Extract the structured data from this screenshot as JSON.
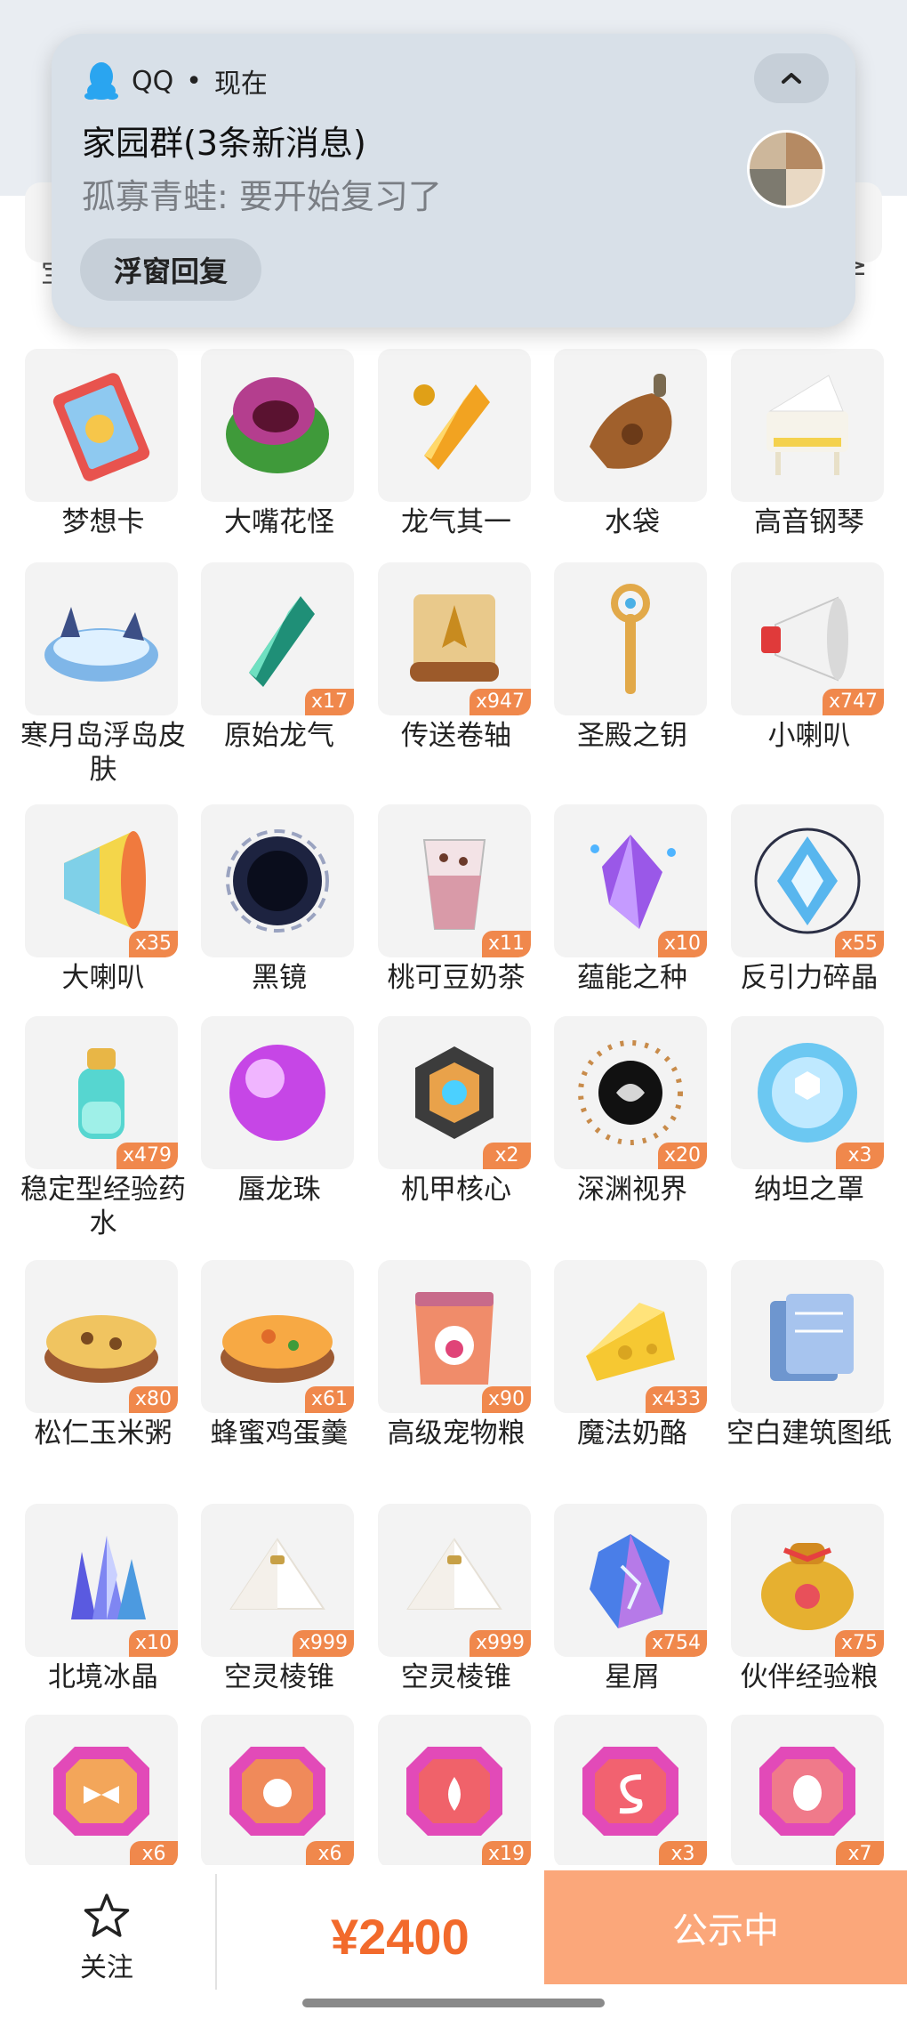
{
  "notification": {
    "app_name": "QQ",
    "separator": "•",
    "time": "现在",
    "title": "家园群(3条新消息)",
    "message": "孤寡青蛙: 要开始复习了",
    "reply_button": "浮窗回复",
    "icons": {
      "app": "qq-penguin-icon",
      "collapse": "chevron-up-icon",
      "avatar": "group-avatar"
    }
  },
  "items": [
    {
      "name": "梦想卡",
      "count": "",
      "icon": "dream-card"
    },
    {
      "name": "大嘴花怪",
      "count": "",
      "icon": "piranha-plant"
    },
    {
      "name": "龙气其一",
      "count": "",
      "icon": "dragon-crystal-gold"
    },
    {
      "name": "水袋",
      "count": "",
      "icon": "water-bag"
    },
    {
      "name": "高音钢琴",
      "count": "",
      "icon": "white-piano"
    },
    {
      "name": "寒月岛浮岛皮肤",
      "count": "",
      "icon": "floating-island"
    },
    {
      "name": "原始龙气",
      "count": "x17",
      "icon": "dragon-crystal-green"
    },
    {
      "name": "传送卷轴",
      "count": "x947",
      "icon": "teleport-scroll"
    },
    {
      "name": "圣殿之钥",
      "count": "",
      "icon": "temple-key"
    },
    {
      "name": "小喇叭",
      "count": "x747",
      "icon": "small-megaphone"
    },
    {
      "name": "大喇叭",
      "count": "x35",
      "icon": "big-megaphone"
    },
    {
      "name": "黑镜",
      "count": "",
      "icon": "black-mirror"
    },
    {
      "name": "桃可豆奶茶",
      "count": "x11",
      "icon": "milk-tea"
    },
    {
      "name": "蕴能之种",
      "count": "x10",
      "icon": "energy-seed"
    },
    {
      "name": "反引力碎晶",
      "count": "x55",
      "icon": "antigravity-crystal"
    },
    {
      "name": "稳定型经验药水",
      "count": "x479",
      "icon": "exp-potion"
    },
    {
      "name": "蜃龙珠",
      "count": "",
      "icon": "purple-orb"
    },
    {
      "name": "机甲核心",
      "count": "x2",
      "icon": "mech-core"
    },
    {
      "name": "深渊视界",
      "count": "x20",
      "icon": "abyss-eye"
    },
    {
      "name": "纳坦之罩",
      "count": "x3",
      "icon": "hex-shield"
    },
    {
      "name": "松仁玉米粥",
      "count": "x80",
      "icon": "corn-porridge"
    },
    {
      "name": "蜂蜜鸡蛋羹",
      "count": "x61",
      "icon": "egg-custard"
    },
    {
      "name": "高级宠物粮",
      "count": "x90",
      "icon": "pet-food-bag"
    },
    {
      "name": "魔法奶酪",
      "count": "x433",
      "icon": "magic-cheese"
    },
    {
      "name": "空白建筑图纸",
      "count": "",
      "icon": "blueprint"
    },
    {
      "name": "北境冰晶",
      "count": "x10",
      "icon": "ice-crystal"
    },
    {
      "name": "空灵棱锥",
      "count": "x999",
      "icon": "ethereal-pyramid"
    },
    {
      "name": "空灵棱锥",
      "count": "x999",
      "icon": "ethereal-pyramid"
    },
    {
      "name": "星屑",
      "count": "x754",
      "icon": "stardust"
    },
    {
      "name": "伙伴经验粮",
      "count": "x75",
      "icon": "partner-exp-bag"
    },
    {
      "name": "",
      "count": "x6",
      "icon": "gem-bow"
    },
    {
      "name": "",
      "count": "x6",
      "icon": "gem-demon"
    },
    {
      "name": "",
      "count": "x19",
      "icon": "gem-flame"
    },
    {
      "name": "",
      "count": "x3",
      "icon": "gem-s"
    },
    {
      "name": "",
      "count": "x7",
      "icon": "gem-egg"
    }
  ],
  "bottom_bar": {
    "follow_label": "关注",
    "price": "¥2400",
    "status_button": "公示中",
    "icons": {
      "follow": "star-outline-icon"
    }
  },
  "colors": {
    "accent": "#f26a2c",
    "badge": "#f0884c",
    "status_button": "#fba77a",
    "notification_bg": "#d8e0e8"
  }
}
